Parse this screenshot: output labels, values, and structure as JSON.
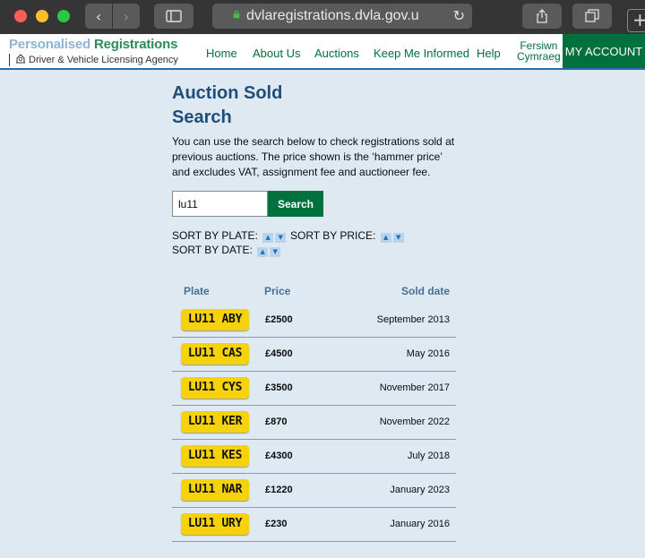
{
  "browser": {
    "url": "dvlaregistrations.dvla.gov.u",
    "icons": [
      "back-icon",
      "forward-icon",
      "sidebar-icon",
      "lock-icon",
      "reload-icon",
      "share-icon",
      "tabs-icon",
      "new-tab-icon"
    ]
  },
  "header": {
    "brand_word1": "Personalised",
    "brand_word2": "Registrations",
    "agency": "Driver & Vehicle Licensing Agency",
    "nav": {
      "home": "Home",
      "about": "About Us",
      "auctions": "Auctions",
      "keep": "Keep Me Informed",
      "help": "Help",
      "welsh_line1": "Fersiwn",
      "welsh_line2": "Cymraeg",
      "account": "MY ACCOUNT"
    }
  },
  "page": {
    "title_line1": "Auction Sold",
    "title_line2": "Search",
    "intro": "You can use the search below to check registrations sold at previous auctions. The price shown is the ‘hammer price’ and excludes VAT, assignment fee and auctioneer fee."
  },
  "search": {
    "value": "lu11",
    "button": "Search"
  },
  "sort": {
    "plate": "SORT BY PLATE:",
    "price": "SORT BY PRICE:",
    "date": "SORT BY DATE:",
    "up": "▲",
    "down": "▼"
  },
  "table": {
    "headers": {
      "plate": "Plate",
      "price": "Price",
      "date": "Sold date"
    },
    "rows": [
      {
        "plate": "LU11 ABY",
        "price": "£2500",
        "date": "September 2013"
      },
      {
        "plate": "LU11 CAS",
        "price": "£4500",
        "date": "May 2016"
      },
      {
        "plate": "LU11 CYS",
        "price": "£3500",
        "date": "November 2017"
      },
      {
        "plate": "LU11 KER",
        "price": "£870",
        "date": "November 2022"
      },
      {
        "plate": "LU11 KES",
        "price": "£4300",
        "date": "July 2018"
      },
      {
        "plate": "LU11 NAR",
        "price": "£1220",
        "date": "January 2023"
      },
      {
        "plate": "LU11 URY",
        "price": "£230",
        "date": "January 2016"
      }
    ]
  },
  "colors": {
    "brand_green": "#00703c",
    "page_background": "#dee9f2",
    "title_blue": "#1d4f7a",
    "plate_yellow": "#f5d20a"
  }
}
